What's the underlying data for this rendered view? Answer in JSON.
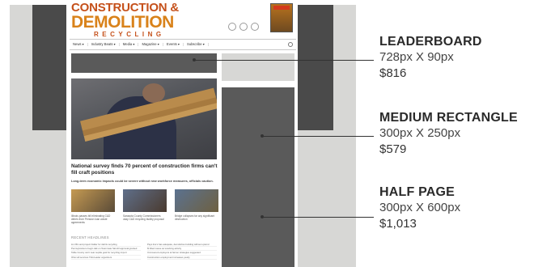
{
  "site": {
    "logo": {
      "line1": "CONSTRUCTION &",
      "line2": "DEMOLITION",
      "line3": "RECYCLING"
    },
    "nav": [
      {
        "label": "News ▾"
      },
      {
        "label": "Industry Beats ▾"
      },
      {
        "label": "Media ▾"
      },
      {
        "label": "Magazine ▾"
      },
      {
        "label": "Events ▾"
      },
      {
        "label": "Subscribe ▾"
      }
    ],
    "headline": "National survey finds 70 percent of construction firms can't fill craft positions",
    "subhead": "Long-term economic impacts could be severe without new workforce measures, officials caution.",
    "thumbs": [
      {
        "caption": "Illinois passes bill eliminating C&D debris from Pension loan waste agreements"
      },
      {
        "caption": "Sarasota County Commissioners okay C&D recycling facility proposal"
      },
      {
        "caption": "Bridge collapses far any significant destruction"
      }
    ],
    "recent_title": "RECENT HEADLINES",
    "recent": [
      [
        "H-1 Bin and project bidder for debris recycling",
        "Pennsylvania to begin talk on Teammate Sal-H3 approval granted",
        "Table County can't near suptile goal for recycling import",
        "Ohio toll services T&G leader organizers"
      ],
      [
        "Pays line's has adequate, demolishes building without upwind",
        "M tilted cause as wrecking activity",
        "Uncovered employers at farmer strategies suggested",
        "Construction employment increases yearly"
      ]
    ]
  },
  "ads": [
    {
      "name": "LEADERBOARD",
      "size": "728px X 90px",
      "price": "$816"
    },
    {
      "name": "MEDIUM RECTANGLE",
      "size": "300px X 250px",
      "price": "$579"
    },
    {
      "name": "HALF PAGE",
      "size": "300px X 600px",
      "price": "$1,013"
    }
  ]
}
